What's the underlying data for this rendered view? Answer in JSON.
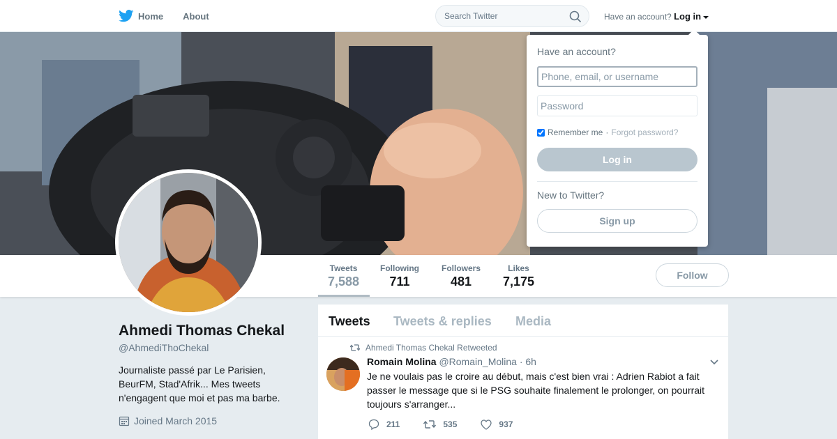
{
  "nav": {
    "home_label": "Home",
    "about_label": "About",
    "search_placeholder": "Search Twitter",
    "account_prompt": "Have an account?",
    "login_label": "Log in"
  },
  "login_dropdown": {
    "title": "Have an account?",
    "username_placeholder": "Phone, email, or username",
    "password_placeholder": "Password",
    "remember_label": "Remember me",
    "separator": "·",
    "forgot_label": "Forgot password?",
    "remember_checked": true,
    "login_button": "Log in",
    "new_prompt": "New to Twitter?",
    "signup_button": "Sign up"
  },
  "profile": {
    "name": "Ahmedi Thomas Chekal",
    "handle": "@AhmediThoChekal",
    "bio": "Journaliste passé par Le Parisien, BeurFM, Stad'Afrik... Mes tweets n'engagent que moi et pas ma barbe.",
    "joined": "Joined March 2015",
    "follow_button": "Follow"
  },
  "stats": [
    {
      "label": "Tweets",
      "value": "7,588"
    },
    {
      "label": "Following",
      "value": "711"
    },
    {
      "label": "Followers",
      "value": "481"
    },
    {
      "label": "Likes",
      "value": "7,175"
    }
  ],
  "timeline": {
    "tabs": [
      "Tweets",
      "Tweets & replies",
      "Media"
    ],
    "retweet_context": "Ahmedi Thomas Chekal Retweeted",
    "tweet": {
      "author": "Romain Molina",
      "handle": "@Romain_Molina",
      "separator": "·",
      "time": "6h",
      "text": "Je ne voulais pas le croire au début, mais c'est bien vrai : Adrien Rabiot a fait passer le message que si le PSG souhaite finalement le prolonger, on pourrait toujours s'arranger...",
      "replies": "211",
      "retweets": "535",
      "likes": "937"
    }
  },
  "colors": {
    "brand": "#1da1f2",
    "text": "#14171a",
    "muted": "#657786",
    "background": "#e6ecf0"
  }
}
